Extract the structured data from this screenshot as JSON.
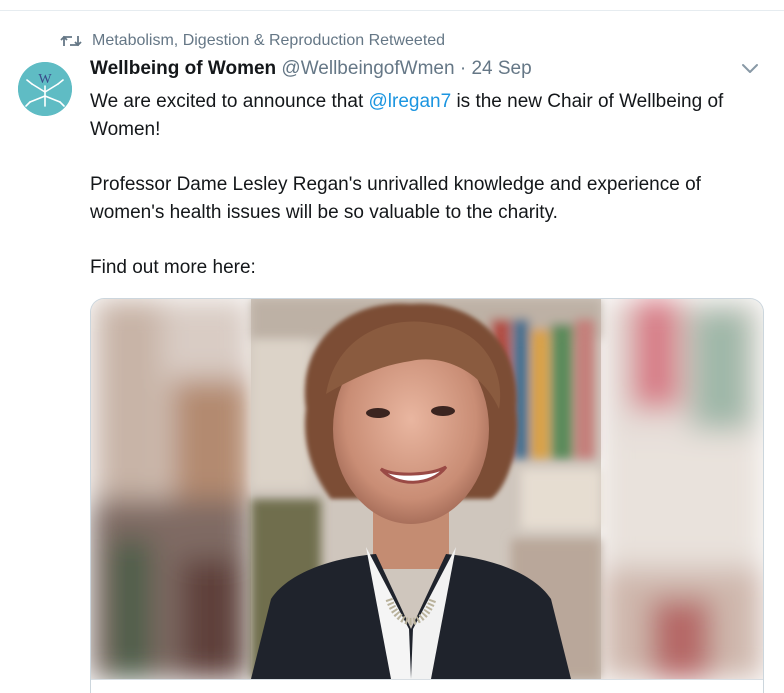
{
  "retweet": {
    "icon": "retweet-icon",
    "text": "Metabolism, Digestion & Reproduction Retweeted"
  },
  "tweet": {
    "author_name": "Wellbeing of Women",
    "handle": "@WellbeingofWmen",
    "separator": "·",
    "date": "24 Sep",
    "avatar_letter": "W",
    "text": {
      "line1_before": "We are excited to announce that ",
      "mention": "@lregan7",
      "line1_after": " is the new Chair of Wellbeing of Women!",
      "paragraph2": "Professor Dame Lesley Regan's unrivalled knowledge and experience of women's health issues will be so valuable to the charity.",
      "paragraph3": "Find out more here:"
    }
  },
  "icons": {
    "menu": "chevron-down-icon",
    "retweet": "retweet-icon"
  },
  "colors": {
    "link": "#1b95e0",
    "secondary_text": "#657786",
    "avatar_bg": "#5fbcc4"
  }
}
